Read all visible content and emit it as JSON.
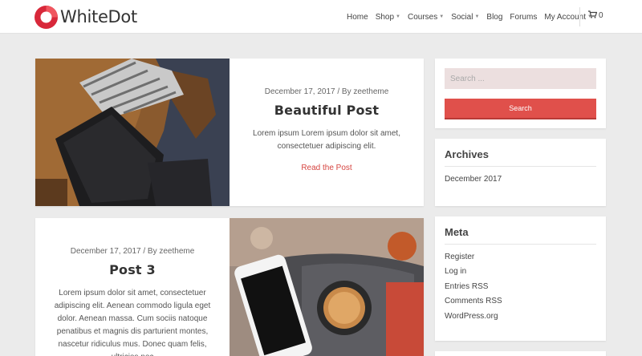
{
  "site": {
    "name": "WhiteDot",
    "brand_color": "#e0504b"
  },
  "nav": {
    "items": [
      {
        "label": "Home",
        "has_dropdown": false
      },
      {
        "label": "Shop",
        "has_dropdown": true
      },
      {
        "label": "Courses",
        "has_dropdown": true
      },
      {
        "label": "Social",
        "has_dropdown": true
      },
      {
        "label": "Blog",
        "has_dropdown": false
      },
      {
        "label": "Forums",
        "has_dropdown": false
      },
      {
        "label": "My Account",
        "has_dropdown": true
      }
    ],
    "cart_count": "0",
    "cart_icon": "cart-icon"
  },
  "posts": [
    {
      "meta": "December 17, 2017 / By zeetheme",
      "title": "Beautiful Post",
      "excerpt": "Lorem ipsum Lorem ipsum dolor sit amet, consectetuer adipiscing elit.",
      "read_more": "Read the Post"
    },
    {
      "meta": "December 17, 2017 / By zeetheme",
      "title": "Post 3",
      "excerpt": "Lorem ipsum dolor sit amet, consectetuer adipiscing elit. Aenean commodo ligula eget dolor. Aenean massa. Cum sociis natoque penatibus et magnis dis parturient montes, nascetur ridiculus mus. Donec quam felis, ultricies nec"
    }
  ],
  "sidebar": {
    "search": {
      "placeholder": "Search ...",
      "button_label": "Search"
    },
    "archives": {
      "title": "Archives",
      "items": [
        "December 2017"
      ]
    },
    "meta": {
      "title": "Meta",
      "items": [
        "Register",
        "Log in",
        "Entries RSS",
        "Comments RSS",
        "WordPress.org"
      ]
    }
  }
}
